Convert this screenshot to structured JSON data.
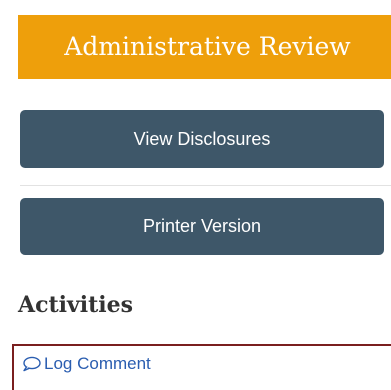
{
  "banner": {
    "status_text": "Administrative Review",
    "color": "#ee9f0b"
  },
  "actions": {
    "view_disclosures_label": "View Disclosures",
    "printer_version_label": "Printer Version",
    "button_color": "#3e5769"
  },
  "activities": {
    "heading": "Activities",
    "log_comment_label": "Log Comment",
    "log_comment_icon": "speech-bubble-icon",
    "border_color": "#7a1f1f",
    "link_color": "#2a5db0"
  }
}
